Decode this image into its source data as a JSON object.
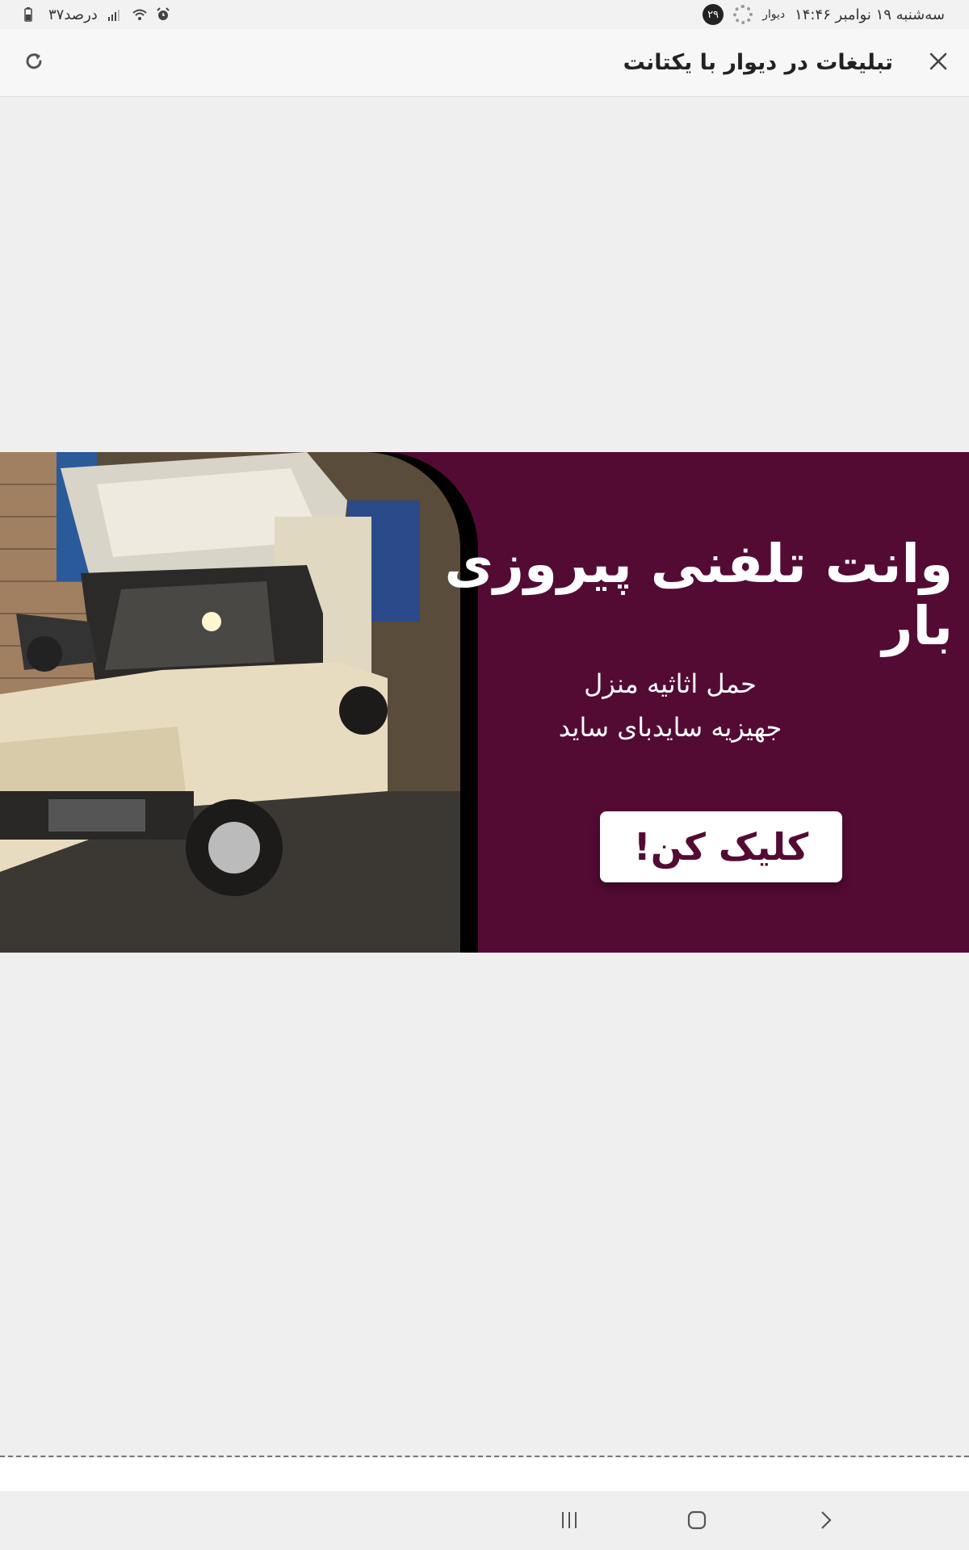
{
  "status_bar": {
    "datetime": "سه‌شنبه ۱۹ نوامبر  ۱۴:۴۶",
    "app_label": "دیوار",
    "notification_count": "۲۹",
    "battery_text": "۳۷درصد"
  },
  "header": {
    "title": "تبلیغات در دیوار با یکتانت"
  },
  "banner": {
    "title": "وانت تلفنی پیروزی بار",
    "subtitle_line1": "حمل اثاثیه منزل",
    "subtitle_line2": "جهیزیه سایدبای ساید",
    "cta_label": "کلیک کن!",
    "background_color": "#540b33"
  },
  "icons": {
    "close": "close-icon",
    "refresh": "refresh-icon",
    "nav_recents": "recents-icon",
    "nav_home": "home-icon",
    "nav_back": "back-icon"
  }
}
